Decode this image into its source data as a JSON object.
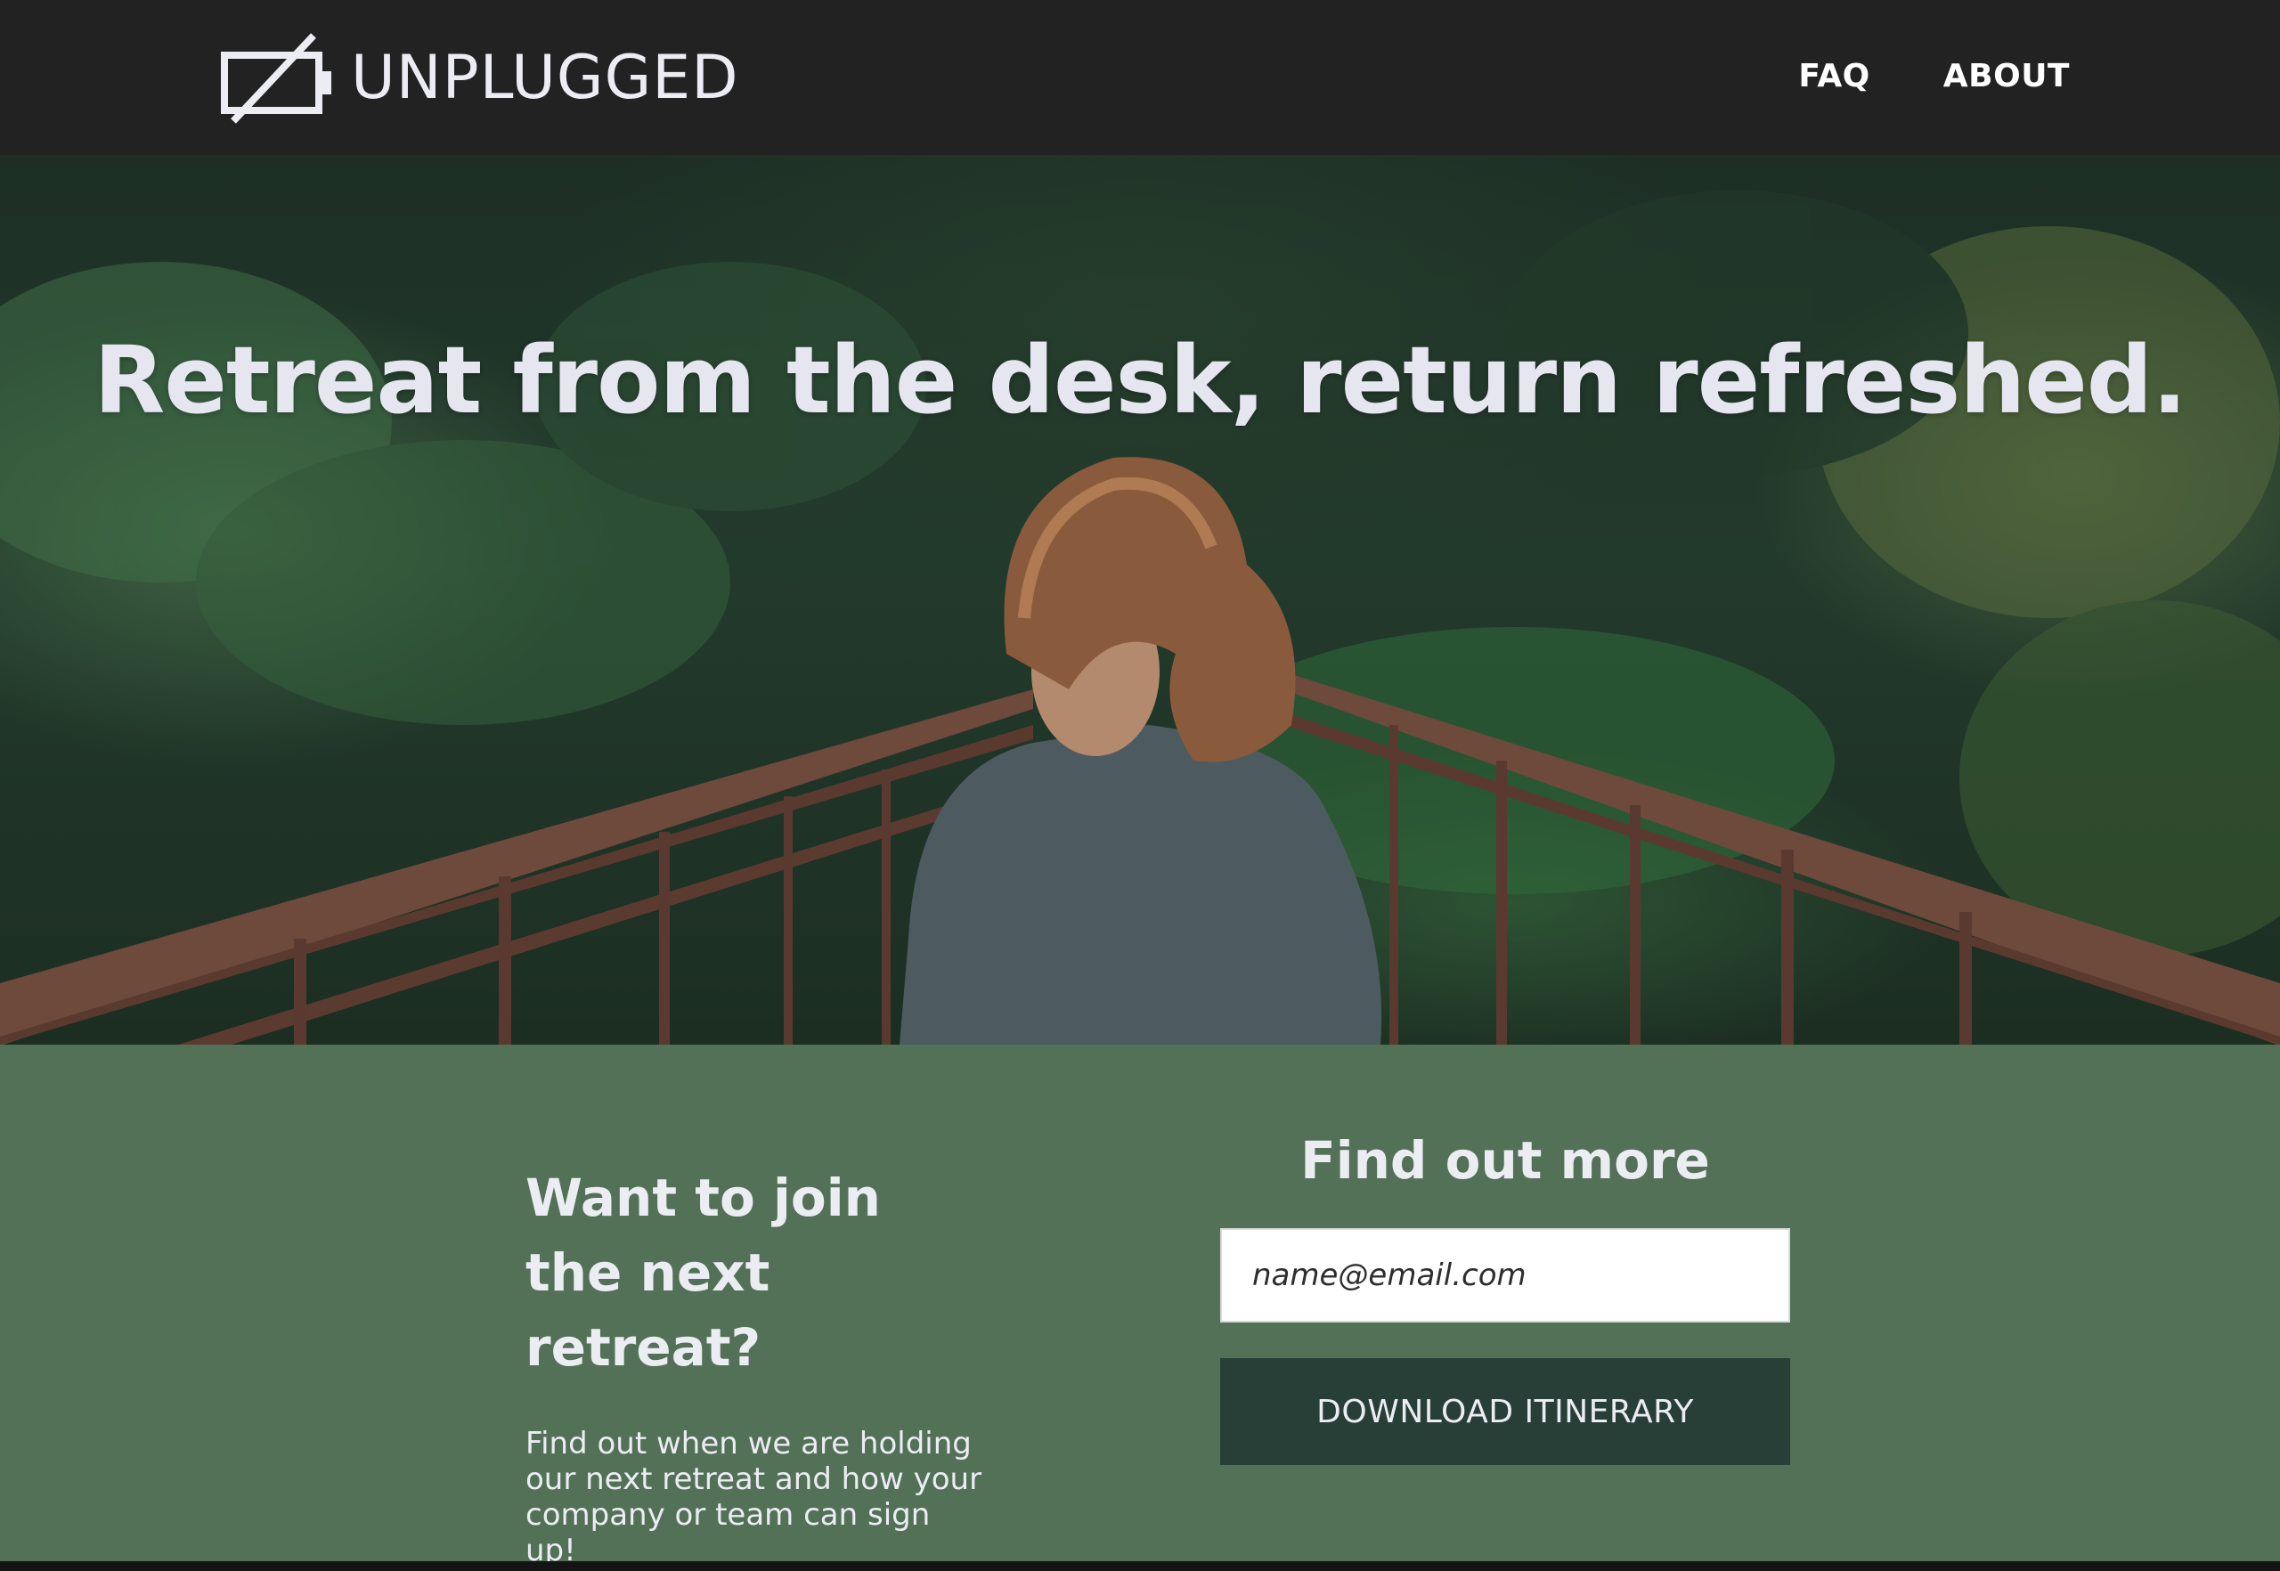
{
  "header": {
    "logo_text": "UNPLUGGED",
    "nav": [
      {
        "label": "FAQ"
      },
      {
        "label": "ABOUT"
      }
    ]
  },
  "hero": {
    "title": "Retreat from the desk, return refreshed."
  },
  "signup": {
    "heading": "Want to join the next retreat?",
    "text": "Find out when we are holding our next retreat and how your company or team can sign up!",
    "form_heading": "Find out more",
    "email_placeholder": "name@email.com",
    "button_label": "DOWNLOAD ITINERARY"
  },
  "colors": {
    "header_bg": "#222222",
    "signup_bg": "#527157",
    "button_bg": "#283F37",
    "text_light": "#ECECF3"
  }
}
